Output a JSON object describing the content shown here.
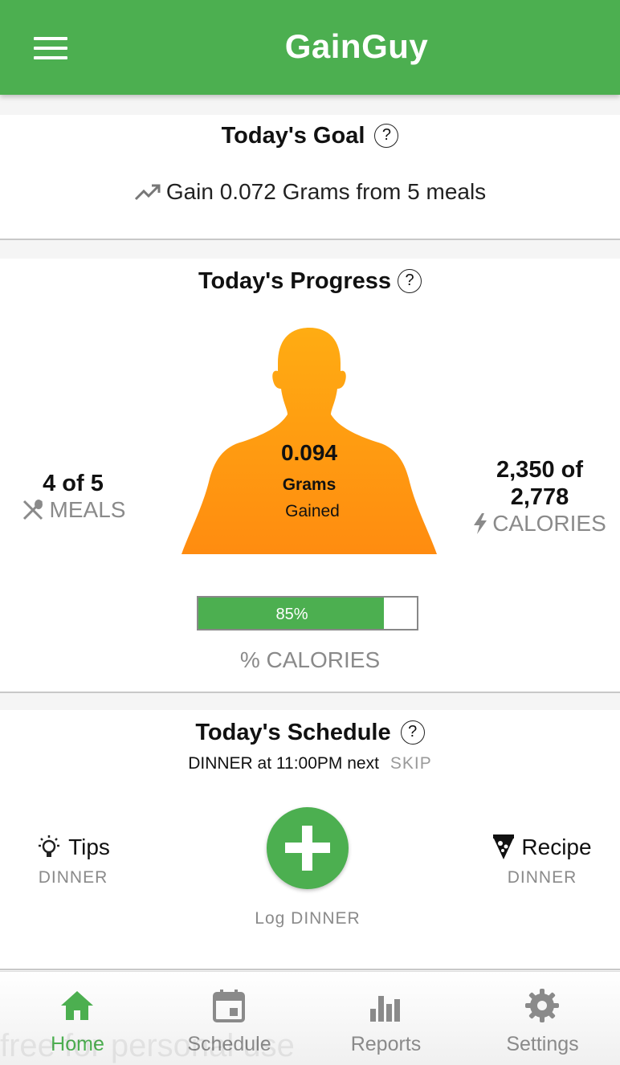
{
  "app": {
    "title": "GainGuy"
  },
  "goal": {
    "title": "Today's Goal",
    "help": "?",
    "text": "Gain 0.072 Grams from 5 meals"
  },
  "progress": {
    "title": "Today's Progress",
    "help": "?",
    "meals": {
      "value": "4 of 5",
      "label": "MEALS"
    },
    "gained": {
      "value": "0.094",
      "unit": "Grams",
      "label": "Gained"
    },
    "calories": {
      "value_line1": "2,350 of",
      "value_line2": "2,778",
      "label": "CALORIES"
    },
    "calories_percent": {
      "label": "85%",
      "fraction": 0.85,
      "caption": "% CALORIES"
    }
  },
  "schedule": {
    "title": "Today's Schedule",
    "help": "?",
    "next": "DINNER at 11:00PM next",
    "skip": "SKIP",
    "tips": {
      "label": "Tips",
      "sub": "DINNER"
    },
    "recipe": {
      "label": "Recipe",
      "sub": "DINNER"
    },
    "log_label": "Log DINNER"
  },
  "nav": [
    {
      "label": "Home",
      "icon": "home-icon",
      "active": true
    },
    {
      "label": "Schedule",
      "icon": "calendar-icon",
      "active": false
    },
    {
      "label": "Reports",
      "icon": "bar-chart-icon",
      "active": false
    },
    {
      "label": "Settings",
      "icon": "gear-icon",
      "active": false
    }
  ],
  "watermark": "free for personal use",
  "colors": {
    "primary": "#4caf50",
    "accent": "#ffa31a",
    "muted": "#8a8a8a"
  }
}
